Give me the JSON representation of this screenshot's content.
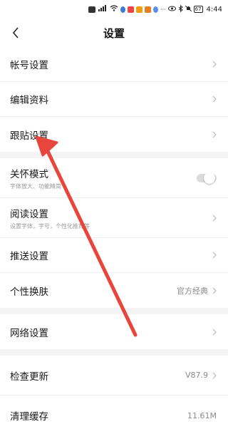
{
  "status_bar": {
    "time": "4:44",
    "battery": "67"
  },
  "header": {
    "title": "设置"
  },
  "section1": [
    {
      "label": "帐号设置"
    },
    {
      "label": "编辑资料"
    },
    {
      "label": "跟贴设置"
    }
  ],
  "section2": [
    {
      "label": "关怀模式",
      "sub": "字体放大、功能精简",
      "toggle_on": false
    },
    {
      "label": "阅读设置",
      "sub": "设置字体，字号，个性化推荐等"
    },
    {
      "label": "推送设置"
    },
    {
      "label": "个性换肤",
      "value": "官方经典"
    }
  ],
  "section3": [
    {
      "label": "网络设置"
    }
  ],
  "section4": [
    {
      "label": "检查更新",
      "value": "V87.9"
    },
    {
      "label": "清理缓存",
      "value": "11.61M"
    }
  ],
  "colors": {
    "annotation_arrow": "#e8453c",
    "divider_band": "#f4f4f4"
  }
}
